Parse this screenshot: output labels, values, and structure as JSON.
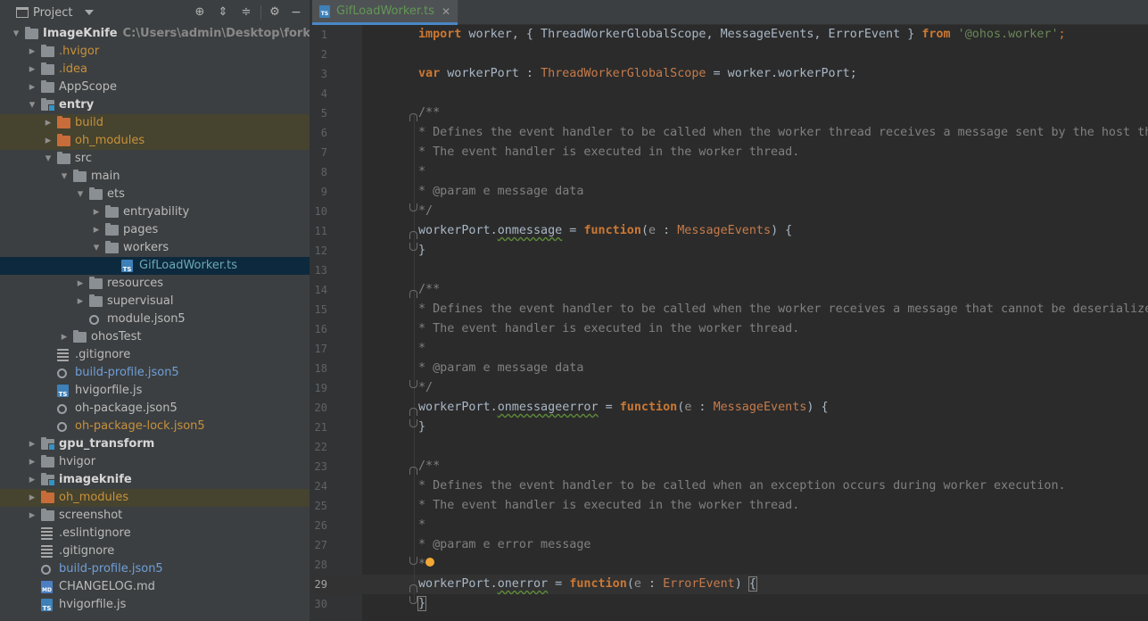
{
  "project_panel": {
    "title": "Project",
    "tree": [
      {
        "label": "ImageKnife",
        "path": "C:\\Users\\admin\\Desktop\\fork_and_syn",
        "depth": 0,
        "arrow": "down",
        "icon": "folder",
        "style": "bold"
      },
      {
        "label": ".hvigor",
        "depth": 1,
        "arrow": "right",
        "icon": "folder",
        "style": "orange"
      },
      {
        "label": ".idea",
        "depth": 1,
        "arrow": "right",
        "icon": "folder",
        "style": "orange"
      },
      {
        "label": "AppScope",
        "depth": 1,
        "arrow": "right",
        "icon": "folder",
        "style": "normal"
      },
      {
        "label": "entry",
        "depth": 1,
        "arrow": "down",
        "icon": "module",
        "style": "bold"
      },
      {
        "label": "build",
        "depth": 2,
        "arrow": "right",
        "icon": "folder-orange",
        "style": "orange",
        "highlight": "yellow"
      },
      {
        "label": "oh_modules",
        "depth": 2,
        "arrow": "right",
        "icon": "folder-orange",
        "style": "orange",
        "highlight": "yellow"
      },
      {
        "label": "src",
        "depth": 2,
        "arrow": "down",
        "icon": "folder",
        "style": "normal"
      },
      {
        "label": "main",
        "depth": 3,
        "arrow": "down",
        "icon": "folder",
        "style": "normal"
      },
      {
        "label": "ets",
        "depth": 4,
        "arrow": "down",
        "icon": "folder",
        "style": "normal"
      },
      {
        "label": "entryability",
        "depth": 5,
        "arrow": "right",
        "icon": "folder",
        "style": "normal"
      },
      {
        "label": "pages",
        "depth": 5,
        "arrow": "right",
        "icon": "folder",
        "style": "normal"
      },
      {
        "label": "workers",
        "depth": 5,
        "arrow": "down",
        "icon": "folder",
        "style": "normal"
      },
      {
        "label": "GifLoadWorker.ts",
        "depth": 6,
        "arrow": "",
        "icon": "ts",
        "style": "cyan",
        "highlight": "blue"
      },
      {
        "label": "resources",
        "depth": 4,
        "arrow": "right",
        "icon": "folder",
        "style": "normal"
      },
      {
        "label": "supervisual",
        "depth": 4,
        "arrow": "right",
        "icon": "folder",
        "style": "normal"
      },
      {
        "label": "module.json5",
        "depth": 4,
        "arrow": "",
        "icon": "gear",
        "style": "normal"
      },
      {
        "label": "ohosTest",
        "depth": 3,
        "arrow": "right",
        "icon": "folder",
        "style": "normal"
      },
      {
        "label": ".gitignore",
        "depth": 2,
        "arrow": "",
        "icon": "lines",
        "style": "normal"
      },
      {
        "label": "build-profile.json5",
        "depth": 2,
        "arrow": "",
        "icon": "gear",
        "style": "blue"
      },
      {
        "label": "hvigorfile.js",
        "depth": 2,
        "arrow": "",
        "icon": "ts",
        "style": "normal"
      },
      {
        "label": "oh-package.json5",
        "depth": 2,
        "arrow": "",
        "icon": "gear",
        "style": "normal"
      },
      {
        "label": "oh-package-lock.json5",
        "depth": 2,
        "arrow": "",
        "icon": "gear",
        "style": "orange"
      },
      {
        "label": "gpu_transform",
        "depth": 1,
        "arrow": "right",
        "icon": "module",
        "style": "bold"
      },
      {
        "label": "hvigor",
        "depth": 1,
        "arrow": "right",
        "icon": "folder",
        "style": "normal"
      },
      {
        "label": "imageknife",
        "depth": 1,
        "arrow": "right",
        "icon": "module",
        "style": "bold"
      },
      {
        "label": "oh_modules",
        "depth": 1,
        "arrow": "right",
        "icon": "folder-orange",
        "style": "orange",
        "highlight": "yellow"
      },
      {
        "label": "screenshot",
        "depth": 1,
        "arrow": "right",
        "icon": "folder",
        "style": "normal"
      },
      {
        "label": ".eslintignore",
        "depth": 1,
        "arrow": "",
        "icon": "lines",
        "style": "normal"
      },
      {
        "label": ".gitignore",
        "depth": 1,
        "arrow": "",
        "icon": "lines",
        "style": "normal"
      },
      {
        "label": "build-profile.json5",
        "depth": 1,
        "arrow": "",
        "icon": "gear",
        "style": "blue"
      },
      {
        "label": "CHANGELOG.md",
        "depth": 1,
        "arrow": "",
        "icon": "md",
        "style": "normal"
      },
      {
        "label": "hvigorfile.js",
        "depth": 1,
        "arrow": "",
        "icon": "ts",
        "style": "normal"
      }
    ]
  },
  "editor": {
    "tab": {
      "label": "GifLoadWorker.ts",
      "close": "✕"
    },
    "current_line": 29,
    "lines": [
      [
        [
          "kwb",
          "import"
        ],
        [
          "plain",
          " worker, { ThreadWorkerGlobalScope, MessageEvents, ErrorEvent } "
        ],
        [
          "kwb",
          "from"
        ],
        [
          "plain",
          " "
        ],
        [
          "str",
          "'@ohos.worker'"
        ],
        [
          "kw",
          ";"
        ]
      ],
      [],
      [
        [
          "kwb",
          "var"
        ],
        [
          "plain",
          " workerPort : "
        ],
        [
          "typ",
          "ThreadWorkerGlobalScope"
        ],
        [
          "plain",
          " = worker.workerPort;"
        ]
      ],
      [],
      [
        [
          "cmt",
          "/**"
        ]
      ],
      [
        [
          "cmt",
          "* Defines the event handler to be called when the worker thread receives a message sent by the host thread."
        ]
      ],
      [
        [
          "cmt",
          "* The event handler is executed in the worker thread."
        ]
      ],
      [
        [
          "cmt",
          "*"
        ]
      ],
      [
        [
          "cmt",
          "* @param e message data"
        ]
      ],
      [
        [
          "cmt",
          "*/"
        ]
      ],
      [
        [
          "plain",
          "workerPort."
        ],
        [
          "wavy",
          "onmessage"
        ],
        [
          "plain",
          " = "
        ],
        [
          "kwb",
          "function"
        ],
        [
          "plain",
          "("
        ],
        [
          "param",
          "e"
        ],
        [
          "plain",
          " : "
        ],
        [
          "typ",
          "MessageEvents"
        ],
        [
          "plain",
          ") {"
        ]
      ],
      [
        [
          "plain",
          "}"
        ]
      ],
      [],
      [
        [
          "cmt",
          "/**"
        ]
      ],
      [
        [
          "cmt",
          "* Defines the event handler to be called when the worker receives a message that cannot be deserialized."
        ]
      ],
      [
        [
          "cmt",
          "* The event handler is executed in the worker thread."
        ]
      ],
      [
        [
          "cmt",
          "*"
        ]
      ],
      [
        [
          "cmt",
          "* @param e message data"
        ]
      ],
      [
        [
          "cmt",
          "*/"
        ]
      ],
      [
        [
          "plain",
          "workerPort."
        ],
        [
          "wavy",
          "onmessageerror"
        ],
        [
          "plain",
          " = "
        ],
        [
          "kwb",
          "function"
        ],
        [
          "plain",
          "("
        ],
        [
          "param",
          "e"
        ],
        [
          "plain",
          " : "
        ],
        [
          "typ",
          "MessageEvents"
        ],
        [
          "plain",
          ") {"
        ]
      ],
      [
        [
          "plain",
          "}"
        ]
      ],
      [],
      [
        [
          "cmt",
          "/**"
        ]
      ],
      [
        [
          "cmt",
          "* Defines the event handler to be called when an exception occurs during worker execution."
        ]
      ],
      [
        [
          "cmt",
          "* The event handler is executed in the worker thread."
        ]
      ],
      [
        [
          "cmt",
          "*"
        ]
      ],
      [
        [
          "cmt",
          "* @param e error message"
        ]
      ],
      [
        [
          "cmt",
          "*"
        ],
        [
          "bulb",
          ""
        ]
      ],
      [
        [
          "plain",
          "workerPort."
        ],
        [
          "wavy",
          "onerror"
        ],
        [
          "plain",
          " = "
        ],
        [
          "kwb",
          "function"
        ],
        [
          "plain",
          "("
        ],
        [
          "param",
          "e"
        ],
        [
          "plain",
          " : "
        ],
        [
          "typ",
          "ErrorEvent"
        ],
        [
          "plain",
          ") "
        ],
        [
          "brace",
          "{"
        ],
        [
          "cursor",
          ""
        ]
      ],
      [
        [
          "brace",
          "}"
        ]
      ]
    ],
    "fold_markers": {
      "5": "down",
      "10": "up",
      "11": "down",
      "12": "up",
      "14": "down",
      "19": "up",
      "20": "down",
      "21": "up",
      "23": "down",
      "28": "up",
      "29": "down",
      "30": "up"
    }
  }
}
